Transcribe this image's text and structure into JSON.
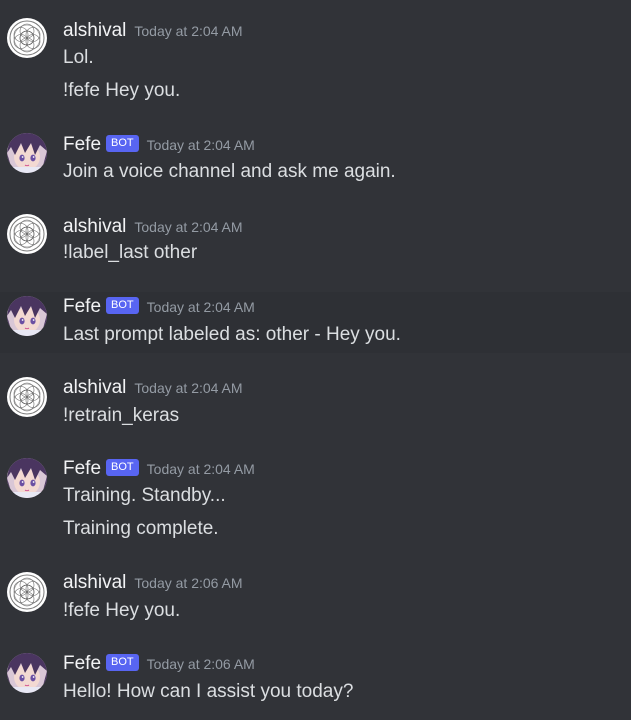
{
  "users": {
    "alshival": "alshival",
    "fefe": "Fefe"
  },
  "bot_tag": "BOT",
  "icons": {
    "alshival_avatar": "geometric-mandala-avatar",
    "fefe_avatar": "anime-character-avatar"
  },
  "colors": {
    "background": "#313338",
    "bot_tag": "#5865f2",
    "timestamp": "#949ba4",
    "username": "#f2f3f5",
    "message_text": "#dbdee1"
  },
  "messages": [
    {
      "author": "alshival",
      "timestamp": "Today at 2:04 AM",
      "lines": [
        "Lol.",
        "!fefe Hey you."
      ]
    },
    {
      "author": "Fefe",
      "bot": true,
      "timestamp": "Today at 2:04 AM",
      "lines": [
        "Join a voice channel and ask me again."
      ]
    },
    {
      "author": "alshival",
      "timestamp": "Today at 2:04 AM",
      "lines": [
        "!label_last other"
      ]
    },
    {
      "author": "Fefe",
      "bot": true,
      "timestamp": "Today at 2:04 AM",
      "lines": [
        "Last prompt labeled as: other - Hey you."
      ]
    },
    {
      "author": "alshival",
      "timestamp": "Today at 2:04 AM",
      "lines": [
        "!retrain_keras"
      ]
    },
    {
      "author": "Fefe",
      "bot": true,
      "timestamp": "Today at 2:04 AM",
      "lines": [
        "Training. Standby...",
        "Training complete."
      ]
    },
    {
      "author": "alshival",
      "timestamp": "Today at 2:06 AM",
      "lines": [
        "!fefe Hey you."
      ]
    },
    {
      "author": "Fefe",
      "bot": true,
      "timestamp": "Today at 2:06 AM",
      "lines": [
        "Hello! How can I assist you today?"
      ]
    }
  ]
}
